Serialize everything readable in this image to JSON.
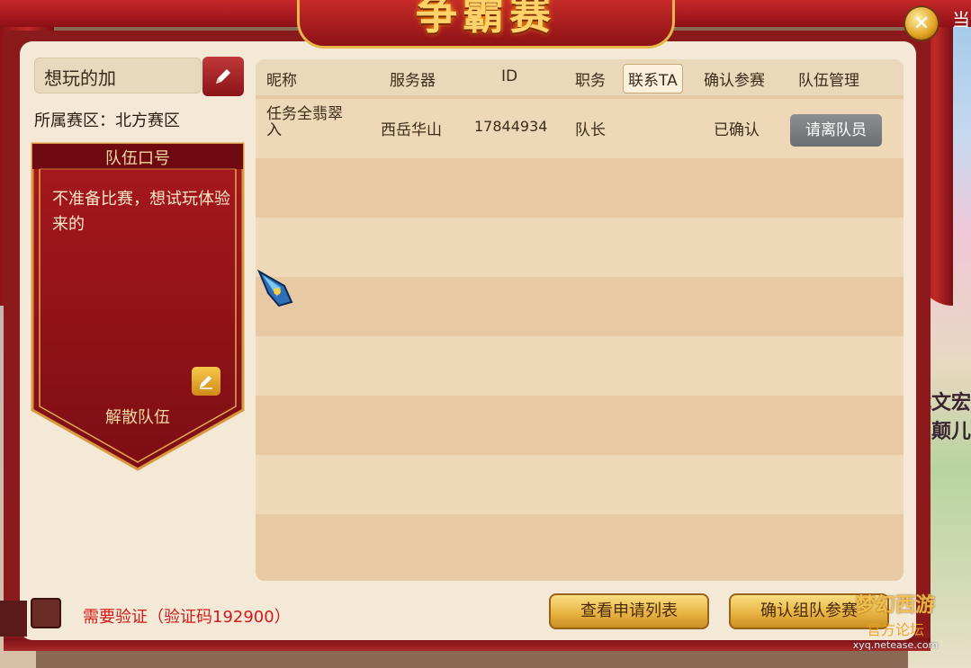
{
  "header": {
    "banner_title": "争霸赛",
    "corner_text": "当",
    "close_label": "✕"
  },
  "team": {
    "name": "想玩的加",
    "region": "所属赛区：北方赛区",
    "slogan_title": "队伍口号",
    "slogan": "不准备比赛，想试玩体验来的",
    "disband_label": "解散队伍"
  },
  "table": {
    "headers": [
      "昵称",
      "服务器",
      "ID",
      "职务",
      "联系TA",
      "确认参赛",
      "队伍管理"
    ],
    "rows": [
      {
        "nickname": "任务全翡翠\n入",
        "server": "西岳华山",
        "id": "17844934",
        "role": "队长",
        "confirm": "已确认",
        "action": "请离队员"
      }
    ]
  },
  "footer": {
    "verify_text": "需要验证（验证码192900）",
    "view_applications": "查看申请列表",
    "confirm_team": "确认组队参赛"
  },
  "background": {
    "side_text_1": "代文宏",
    "side_text_2": "豆颠儿"
  },
  "watermark": {
    "brand": "梦幻西游",
    "subtitle": "官方论坛",
    "url": "xyq.netease.com"
  },
  "colors": {
    "frame_red": "#8a1a1c",
    "panel_bg": "#f3e9d6",
    "gold": "#e8b443",
    "verify_red": "#d41a1a"
  }
}
